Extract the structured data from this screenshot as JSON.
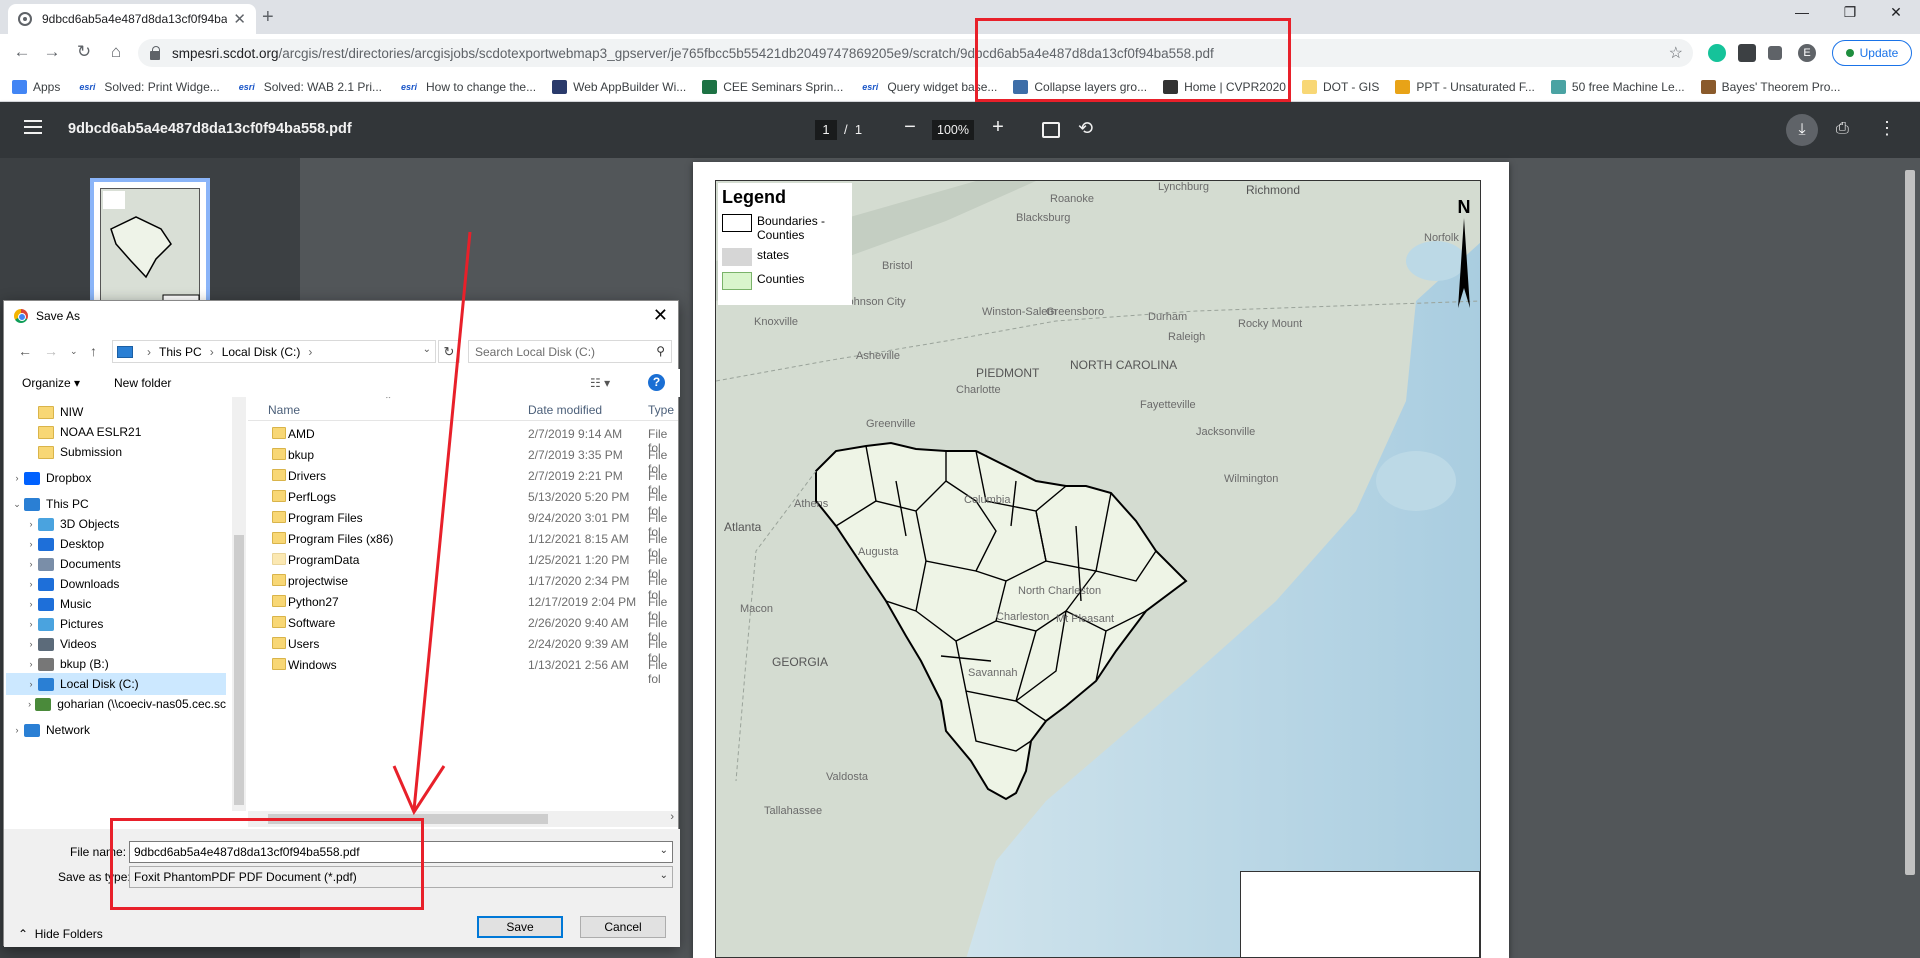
{
  "browser": {
    "tab_title": "9dbcd6ab5a4e487d8da13cf0f94ba558.pdf",
    "url_host": "smpesri.scdot.org",
    "url_path": "/arcgis/rest/directories/arcgisjobs/scdotexportwebmap3_gpserver/je765fbcc5b55421db2049747869205e9/scratch/9dbcd6ab5a4e487d8da13cf0f94ba558.pdf",
    "profile_initial": "E",
    "update_label": "Update"
  },
  "bookmarks": [
    {
      "label": "Apps",
      "icon": "apps-grid-icon",
      "color": "#4285f4"
    },
    {
      "label": "Solved: Print Widge...",
      "icon": "esri-icon",
      "color": "#1a56c8",
      "badge": "esri"
    },
    {
      "label": "Solved: WAB 2.1 Pri...",
      "icon": "esri-icon",
      "color": "#1a56c8",
      "badge": "esri"
    },
    {
      "label": "How to change the...",
      "icon": "esri-icon",
      "color": "#1a56c8",
      "badge": "esri"
    },
    {
      "label": "Web AppBuilder Wi...",
      "icon": "web-appbuilder-icon",
      "color": "#2a3a6b"
    },
    {
      "label": "CEE Seminars Sprin...",
      "icon": "excel-icon",
      "color": "#1d7244"
    },
    {
      "label": "Query widget base...",
      "icon": "esri-icon",
      "color": "#1a56c8",
      "badge": "esri"
    },
    {
      "label": "Collapse layers gro...",
      "icon": "stack-icon",
      "color": "#3d6ea8"
    },
    {
      "label": "Home | CVPR2020",
      "icon": "cvpr-icon",
      "color": "#333"
    },
    {
      "label": "DOT - GIS",
      "icon": "folder-icon",
      "color": "#f8d775"
    },
    {
      "label": "PPT - Unsaturated F...",
      "icon": "ppt-icon",
      "color": "#e8a317"
    },
    {
      "label": "50 free Machine Le...",
      "icon": "ml-icon",
      "color": "#4aa3a3"
    },
    {
      "label": "Bayes' Theorem Pro...",
      "icon": "bayes-icon",
      "color": "#8a5a2b"
    }
  ],
  "pdf": {
    "file_name": "9dbcd6ab5a4e487d8da13cf0f94ba558.pdf",
    "current_page": "1",
    "page_sep": "/",
    "total_pages": "1",
    "zoom": "100%"
  },
  "map": {
    "legend_title": "Legend",
    "legend_items": [
      {
        "label": "Boundaries - Counties",
        "fill": "#ffffff",
        "stroke": "#000000"
      },
      {
        "label": "states",
        "fill": "#d6d6d6",
        "stroke": "#d6d6d6"
      },
      {
        "label": "Counties",
        "fill": "#d9f5cc",
        "stroke": "#7ab36a"
      }
    ],
    "north": "N",
    "places": [
      {
        "label": "Lynchburg",
        "cls": ""
      },
      {
        "label": "Richmond",
        "cls": "big"
      },
      {
        "label": "Roanoke",
        "cls": ""
      },
      {
        "label": "Blacksburg",
        "cls": ""
      },
      {
        "label": "Bristol",
        "cls": ""
      },
      {
        "label": "Johnson City",
        "cls": ""
      },
      {
        "label": "Knoxville",
        "cls": ""
      },
      {
        "label": "Winston-Salem",
        "cls": ""
      },
      {
        "label": "Greensboro",
        "cls": ""
      },
      {
        "label": "Durham",
        "cls": ""
      },
      {
        "label": "Raleigh",
        "cls": ""
      },
      {
        "label": "Rocky Mount",
        "cls": ""
      },
      {
        "label": "PIEDMONT",
        "cls": "big"
      },
      {
        "label": "NORTH CAROLINA",
        "cls": "big"
      },
      {
        "label": "Asheville",
        "cls": ""
      },
      {
        "label": "Greenville",
        "cls": ""
      },
      {
        "label": "Charlotte",
        "cls": ""
      },
      {
        "label": "Fayetteville",
        "cls": ""
      },
      {
        "label": "Jacksonville",
        "cls": ""
      },
      {
        "label": "Wilmington",
        "cls": ""
      },
      {
        "label": "Athens",
        "cls": ""
      },
      {
        "label": "Atlanta",
        "cls": "big"
      },
      {
        "label": "Columbia",
        "cls": ""
      },
      {
        "label": "Augusta",
        "cls": ""
      },
      {
        "label": "Macon",
        "cls": ""
      },
      {
        "label": "GEORGIA",
        "cls": "big"
      },
      {
        "label": "North Charleston",
        "cls": ""
      },
      {
        "label": "Charleston",
        "cls": ""
      },
      {
        "label": "Mt Pleasant",
        "cls": ""
      },
      {
        "label": "Savannah",
        "cls": ""
      },
      {
        "label": "Valdosta",
        "cls": ""
      },
      {
        "label": "Tallahassee",
        "cls": ""
      },
      {
        "label": "Norfolk",
        "cls": ""
      },
      {
        "label": "Greenville",
        "cls": ""
      }
    ]
  },
  "dialog": {
    "title": "Save As",
    "breadcrumb": [
      "This PC",
      "Local Disk (C:)"
    ],
    "search_placeholder": "Search Local Disk (C:)",
    "organize": "Organize",
    "new_folder": "New folder",
    "help": "?",
    "nav_items": [
      {
        "label": "NIW",
        "icon": "folder-icon",
        "indent": 1,
        "twisty": "",
        "selected": false
      },
      {
        "label": "NOAA ESLR21",
        "icon": "folder-icon",
        "indent": 1,
        "twisty": "",
        "selected": false
      },
      {
        "label": "Submission",
        "icon": "folder-icon",
        "indent": 1,
        "twisty": "",
        "selected": false
      },
      {
        "label": "Dropbox",
        "icon": "dropbox-icon",
        "indent": 0,
        "twisty": ">",
        "selected": false
      },
      {
        "label": "This PC",
        "icon": "pc-icon",
        "indent": 0,
        "twisty": "v",
        "selected": false
      },
      {
        "label": "3D Objects",
        "icon": "cube-icon",
        "indent": 1,
        "twisty": ">",
        "selected": false
      },
      {
        "label": "Desktop",
        "icon": "desktop-icon",
        "indent": 1,
        "twisty": ">",
        "selected": false
      },
      {
        "label": "Documents",
        "icon": "documents-icon",
        "indent": 1,
        "twisty": ">",
        "selected": false
      },
      {
        "label": "Downloads",
        "icon": "download-icon",
        "indent": 1,
        "twisty": ">",
        "selected": false
      },
      {
        "label": "Music",
        "icon": "music-icon",
        "indent": 1,
        "twisty": ">",
        "selected": false
      },
      {
        "label": "Pictures",
        "icon": "pictures-icon",
        "indent": 1,
        "twisty": ">",
        "selected": false
      },
      {
        "label": "Videos",
        "icon": "videos-icon",
        "indent": 1,
        "twisty": ">",
        "selected": false
      },
      {
        "label": "bkup (B:)",
        "icon": "drive-icon",
        "indent": 1,
        "twisty": ">",
        "selected": false
      },
      {
        "label": "Local Disk (C:)",
        "icon": "windows-drive-icon",
        "indent": 1,
        "twisty": ">",
        "selected": true
      },
      {
        "label": "goharian (\\\\coeciv-nas05.cec.sc",
        "icon": "network-drive-icon",
        "indent": 1,
        "twisty": ">",
        "selected": false
      },
      {
        "label": "Network",
        "icon": "network-icon",
        "indent": 0,
        "twisty": ">",
        "selected": false
      }
    ],
    "columns": {
      "name": "Name",
      "date": "Date modified",
      "type": "Type"
    },
    "files": [
      {
        "name": "AMD",
        "date": "2/7/2019 9:14 AM",
        "type": "File fol"
      },
      {
        "name": "bkup",
        "date": "2/7/2019 3:35 PM",
        "type": "File fol"
      },
      {
        "name": "Drivers",
        "date": "2/7/2019 2:21 PM",
        "type": "File fol"
      },
      {
        "name": "PerfLogs",
        "date": "5/13/2020 5:20 PM",
        "type": "File fol"
      },
      {
        "name": "Program Files",
        "date": "9/24/2020 3:01 PM",
        "type": "File fol"
      },
      {
        "name": "Program Files (x86)",
        "date": "1/12/2021 8:15 AM",
        "type": "File fol"
      },
      {
        "name": "ProgramData",
        "date": "1/25/2021 1:20 PM",
        "type": "File fol"
      },
      {
        "name": "projectwise",
        "date": "1/17/2020 2:34 PM",
        "type": "File fol"
      },
      {
        "name": "Python27",
        "date": "12/17/2019 2:04 PM",
        "type": "File fol"
      },
      {
        "name": "Software",
        "date": "2/26/2020 9:40 AM",
        "type": "File fol"
      },
      {
        "name": "Users",
        "date": "2/24/2020 9:39 AM",
        "type": "File fol"
      },
      {
        "name": "Windows",
        "date": "1/13/2021 2:56 AM",
        "type": "File fol"
      }
    ],
    "file_name_label": "File name:",
    "file_name_value": "9dbcd6ab5a4e487d8da13cf0f94ba558.pdf",
    "save_type_label": "Save as type:",
    "save_type_value": "Foxit PhantomPDF PDF Document (*.pdf)",
    "hide_folders": "Hide Folders",
    "save_button": "Save",
    "cancel_button": "Cancel"
  },
  "annotation_color": "#e8202a"
}
